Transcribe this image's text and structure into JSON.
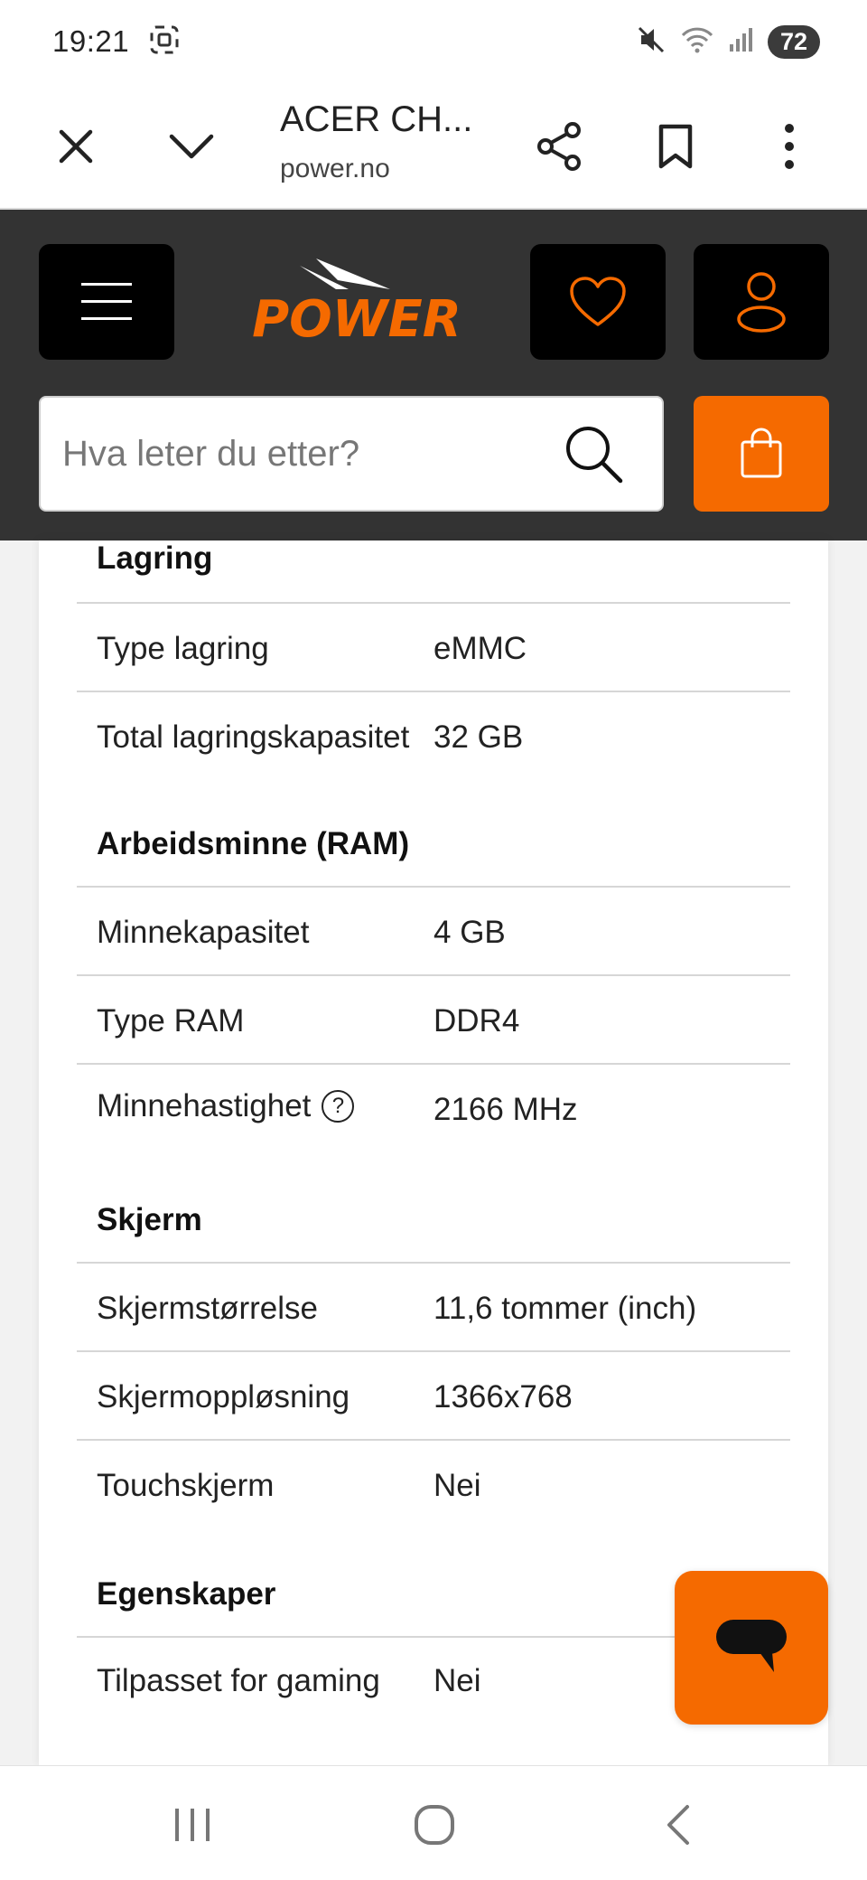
{
  "status_bar": {
    "time": "19:21",
    "battery": "72",
    "icons": [
      "screenshot-icon",
      "mute-icon",
      "wifi-icon",
      "signal-icon"
    ]
  },
  "browser": {
    "title": "ACER CH...",
    "domain": "power.no"
  },
  "header": {
    "logo_text": "POWER",
    "search_placeholder": "Hva leter du etter?",
    "accent_color": "#f56a00",
    "header_bg": "#333333"
  },
  "specs": {
    "sections": [
      {
        "title": "Lagring",
        "rows": [
          {
            "label": "Type lagring",
            "value": "eMMC"
          },
          {
            "label": "Total lagringskapasitet",
            "value": "32 GB"
          }
        ]
      },
      {
        "title": "Arbeidsminne (RAM)",
        "rows": [
          {
            "label": "Minnekapasitet",
            "value": "4 GB"
          },
          {
            "label": "Type RAM",
            "value": "DDR4"
          },
          {
            "label": "Minnehastighet",
            "value": "2166 MHz",
            "help_icon": "?"
          }
        ]
      },
      {
        "title": "Skjerm",
        "rows": [
          {
            "label": "Skjermstørrelse",
            "value": "11,6 tommer (inch)"
          },
          {
            "label": "Skjermoppløsning",
            "value": "1366x768"
          },
          {
            "label": "Touchskjerm",
            "value": "Nei"
          }
        ]
      },
      {
        "title": "Egenskaper",
        "rows": [
          {
            "label": "Tilpasset for gaming",
            "value": "Nei"
          }
        ]
      }
    ]
  }
}
